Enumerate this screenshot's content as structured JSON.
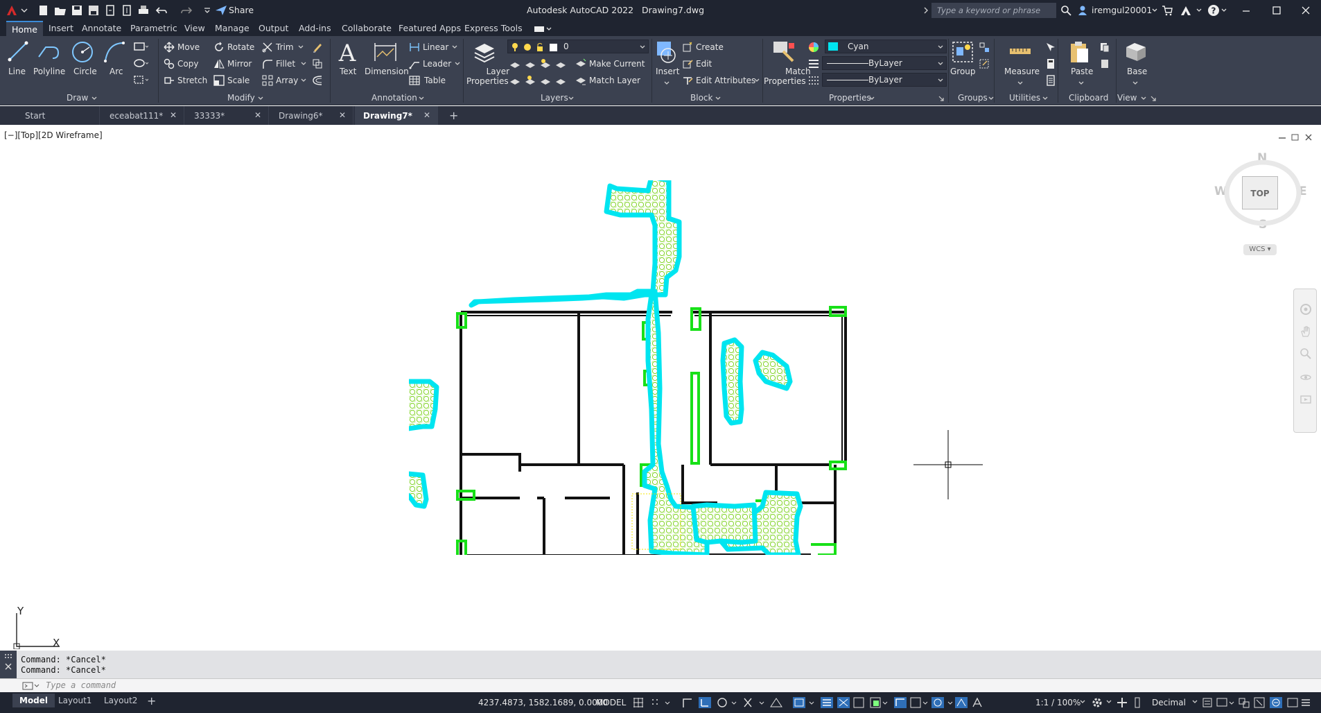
{
  "titlebar": {
    "app_name": "Autodesk AutoCAD 2022",
    "file_name": "Drawing7.dwg",
    "share_label": "Share",
    "search_placeholder": "Type a keyword or phrase",
    "user": "iremgul20001"
  },
  "ribbon_tabs": [
    "Home",
    "Insert",
    "Annotate",
    "Parametric",
    "View",
    "Manage",
    "Output",
    "Add-ins",
    "Collaborate",
    "Featured Apps",
    "Express Tools"
  ],
  "ribbon": {
    "draw": {
      "title": "Draw",
      "line": "Line",
      "polyline": "Polyline",
      "circle": "Circle",
      "arc": "Arc"
    },
    "modify": {
      "title": "Modify",
      "move": "Move",
      "rotate": "Rotate",
      "trim": "Trim",
      "copy": "Copy",
      "mirror": "Mirror",
      "fillet": "Fillet",
      "stretch": "Stretch",
      "scale": "Scale",
      "array": "Array"
    },
    "annotation": {
      "title": "Annotation",
      "text": "Text",
      "dimension": "Dimension",
      "linear": "Linear",
      "leader": "Leader",
      "table": "Table"
    },
    "layers": {
      "title": "Layers",
      "layer_properties_1": "Layer",
      "layer_properties_2": "Properties",
      "current_layer": "0",
      "make_current": "Make Current",
      "match_layer": "Match Layer"
    },
    "block": {
      "title": "Block",
      "insert": "Insert",
      "create": "Create",
      "edit": "Edit",
      "edit_attributes": "Edit Attributes"
    },
    "properties": {
      "title": "Properties",
      "match_1": "Match",
      "match_2": "Properties",
      "color": "Cyan",
      "linetype": "ByLayer",
      "lineweight": "ByLayer",
      "color_hex": "#00e5f0"
    },
    "groups": {
      "title": "Groups",
      "group": "Group"
    },
    "utilities": {
      "title": "Utilities",
      "measure": "Measure"
    },
    "clipboard": {
      "title": "Clipboard",
      "paste": "Paste"
    },
    "view": {
      "title": "View",
      "base": "Base"
    }
  },
  "file_tabs": [
    {
      "label": "Start"
    },
    {
      "label": "eceabat111*"
    },
    {
      "label": "33333*"
    },
    {
      "label": "Drawing6*"
    },
    {
      "label": "Drawing7*"
    }
  ],
  "viewport": {
    "label": "[−][Top][2D Wireframe]",
    "viewcube": {
      "n": "N",
      "s": "S",
      "e": "E",
      "w": "W",
      "top": "TOP",
      "wcs": "WCS"
    },
    "ucs": {
      "x": "X",
      "y": "Y"
    }
  },
  "command": {
    "history": [
      "Command: *Cancel*",
      "Command: *Cancel*"
    ],
    "placeholder": "Type a command"
  },
  "status": {
    "layout_tabs": [
      "Model",
      "Layout1",
      "Layout2"
    ],
    "coords": "4237.4873, 1582.1689, 0.0000",
    "model": "MODEL",
    "scale": "1:1 / 100%",
    "units": "Decimal"
  }
}
